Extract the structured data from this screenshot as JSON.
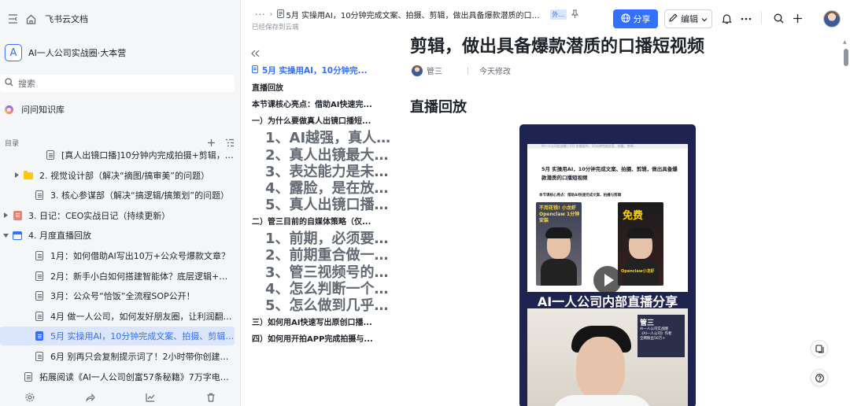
{
  "app": {
    "brand": "飞书云文档"
  },
  "space": {
    "logo_letter": "A",
    "name": "AI一人公司实战圈·大本营"
  },
  "search": {
    "placeholder": "搜索"
  },
  "ask": {
    "label": "问问知识库"
  },
  "toc": {
    "label": "目录"
  },
  "tree": [
    {
      "label": "[真人出镜口播]10分钟内完成拍摄+剪辑，做一条...",
      "icon": "doc-icon",
      "indent": 58,
      "arrow": false,
      "active": false
    },
    {
      "label": "2. 视觉设计部（解决“摘图/搞审美”的问题）",
      "icon": "folder-icon",
      "indent": 30,
      "arrow": true,
      "active": false
    },
    {
      "label": "3. 核心参谋部（解决“搞逻辑/搞策划”的问题）",
      "icon": "doc-icon",
      "indent": 44,
      "arrow": false,
      "active": false
    },
    {
      "label": "3. 日记：CEO实战日记（持续更新）",
      "icon": "notebook-icon",
      "indent": 16,
      "arrow": true,
      "active": false
    },
    {
      "label": "4. 月度直播回放",
      "icon": "table-icon",
      "indent": 16,
      "arrow": "down",
      "active": false
    },
    {
      "label": " 1月：如何借助AI写出10万+公众号爆款文章？",
      "icon": "doc-icon",
      "indent": 44,
      "arrow": false,
      "active": false
    },
    {
      "label": "2月：新手小白如何搭建智能体？底层逻辑+国内...",
      "icon": "doc-icon",
      "indent": 44,
      "arrow": false,
      "active": false
    },
    {
      "label": "3月：公众号“恰饭”全流程SOP公开！",
      "icon": "doc-icon",
      "indent": 44,
      "arrow": false,
      "active": false
    },
    {
      "label": "4月 做一人公司，如何发好朋友圈，让利润翻倍?",
      "icon": "doc-icon",
      "indent": 44,
      "arrow": false,
      "active": false
    },
    {
      "label": "5月 实操用AI，10分钟完成文案、拍摄、剪辑，...",
      "icon": "doc-icon",
      "indent": 44,
      "arrow": false,
      "active": true
    },
    {
      "label": "6月 别再只会复制提示词了！2小时带你创建第一...",
      "icon": "doc-icon",
      "indent": 44,
      "arrow": false,
      "active": false
    },
    {
      "label": "拓展阅读《AI一人公司创富57条秘籍》7万字电子版 学...",
      "icon": "doc-icon",
      "indent": 30,
      "arrow": false,
      "active": false
    }
  ],
  "header": {
    "more": "···",
    "breadcrumb_title": "5月  实操用AI，10分钟完成文案、拍摄、剪辑，做出具备爆款潜质的口播...",
    "external_tag": "外...",
    "saved_status": "已经保存到云端",
    "share_label": "分享",
    "edit_label": "编辑"
  },
  "outline": {
    "items": [
      {
        "label": "5月  实操用AI，10分钟完...",
        "level": 0
      },
      {
        "label": "直播回放",
        "level": 1
      },
      {
        "label": "本节课核心亮点：借助AI快速完...",
        "level": 1
      },
      {
        "label": "一）为什么要做真人出镜口播短...",
        "level": 1
      },
      {
        "label": "1、AI越强，真人越值钱（AI时...",
        "level": 2
      },
      {
        "label": "2、真人出镜最大的优势，是建...",
        "level": 2
      },
      {
        "label": "3、表达能力是未来非常重要的...",
        "level": 2
      },
      {
        "label": "4、露脸，是在放大人生机会",
        "level": 2
      },
      {
        "label": "5、真人出镜口播，其实门槛没...",
        "level": 2
      },
      {
        "label": "二）管三目前的自媒体策略（仅...",
        "level": 1
      },
      {
        "label": "1、前期，必须要有自己的主要...",
        "level": 2
      },
      {
        "label": "2、前期重合做一个平台",
        "level": 2
      },
      {
        "label": "3、管三视频号的短视频选题来...",
        "level": 2
      },
      {
        "label": "4、怎么判断一个选题是否值得...",
        "level": 2
      },
      {
        "label": "5、怎么做到几乎日更?",
        "level": 2
      },
      {
        "label": "三）如何用AI快速写出原创口播...",
        "level": 1
      },
      {
        "label": "四）如何用开拍APP完成拍摄与...",
        "level": 1
      }
    ]
  },
  "doc": {
    "title_tail": "剪辑，做出具备爆款潜质的口播短视频",
    "author": "管三",
    "modified": "今天修改",
    "section_heading": "直播回放",
    "video": {
      "screenshot_bar": "AI一人公司实战圈 | 5月 实操用AI，10分钟完成文案、拍摄、剪辑...",
      "screenshot_title": "5月  实操用AI，10分钟完成文案、拍摄、剪辑，做出具备爆款潜质的口播短视频",
      "screenshot_subheading": "本节课核心亮点：借助AI快速完成文案、拍摄与剪辑",
      "thumb1_caption": "不用花钱! 小龙虾Openclaw 1分钟安装",
      "thumb2_caption": "免费",
      "thumb2_sub": "Openclaw小龙虾",
      "caption": "AI一人公司内部直播分享",
      "speaker_name": "管三",
      "speaker_lines": [
        "AI一人公司实战圈",
        "《AI一人公司》作者",
        "全网粉丝50万+"
      ]
    }
  },
  "colors": {
    "accent": "#3370ff",
    "active_bg": "#dbe5fb",
    "sidebar_bg": "#f5f6f7"
  }
}
